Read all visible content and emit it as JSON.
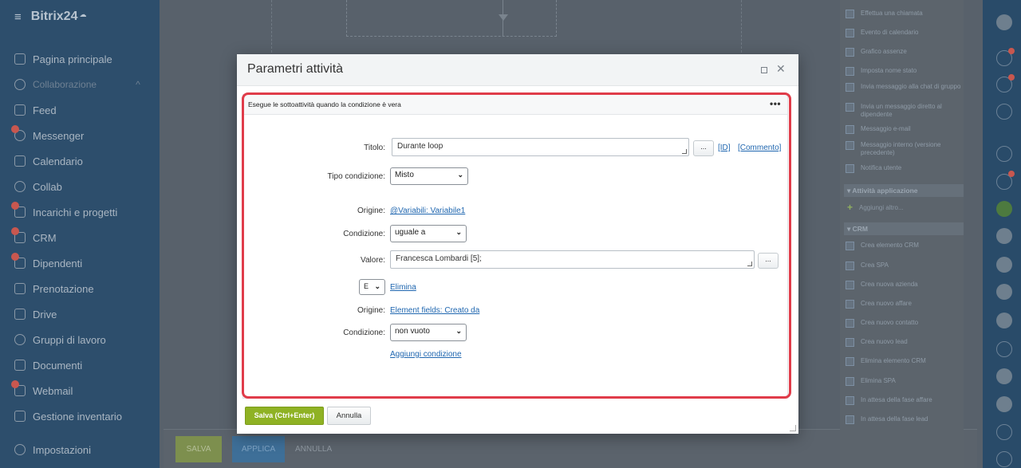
{
  "sidebar": {
    "brand": "Bitrix24",
    "items": [
      {
        "label": "Pagina principale"
      },
      {
        "label": "Collaborazione"
      },
      {
        "label": "Feed"
      },
      {
        "label": "Messenger"
      },
      {
        "label": "Calendario"
      },
      {
        "label": "Collab"
      },
      {
        "label": "Incarichi e progetti"
      },
      {
        "label": "CRM"
      },
      {
        "label": "Dipendenti"
      },
      {
        "label": "Prenotazione"
      },
      {
        "label": "Drive"
      },
      {
        "label": "Gruppi di lavoro"
      },
      {
        "label": "Documenti"
      },
      {
        "label": "Webmail"
      },
      {
        "label": "Gestione inventario"
      },
      {
        "label": "Impostazioni"
      }
    ]
  },
  "background_bar": {
    "save": "SALVA",
    "apply": "APPLICA",
    "cancel": "ANNULLA"
  },
  "right_panel": {
    "items_top": [
      "Effettua una chiamata",
      "Evento di calendario",
      "Grafico assenze",
      "Imposta nome stato",
      "Invia messaggio alla chat di gruppo",
      "Invia un messaggio diretto al dipendente",
      "Messaggio e-mail",
      "Messaggio interno (versione precedente)",
      "Notifica utente"
    ],
    "section_app": "Attività applicazione",
    "add_more": "Aggiungi altro...",
    "section_crm": "CRM",
    "items_crm": [
      "Crea elemento CRM",
      "Crea SPA",
      "Crea nuova azienda",
      "Crea nuovo affare",
      "Crea nuovo contatto",
      "Crea nuovo lead",
      "Elimina elemento CRM",
      "Elimina SPA",
      "In attesa della fase affare",
      "In attesa della fase lead"
    ]
  },
  "modal": {
    "title": "Parametri attività",
    "description": "Esegue le sottoattività quando la condizione è vera",
    "title_label": "Titolo:",
    "title_value": "Durante loop",
    "id_link": "[ID]",
    "comment_link": "[Commento]",
    "condition_type_label": "Tipo condizione:",
    "condition_type_value": "Misto",
    "origin_label": "Origine:",
    "origin1_value": "@Variabili: Variabile1",
    "condition_label": "Condizione:",
    "condition1_value": "uguale a",
    "value_label": "Valore:",
    "value1": "Francesca Lombardi [5];",
    "operator_value": "E",
    "delete_link": "Elimina",
    "origin2_value": "Element fields: Creato da",
    "condition2_value": "non vuoto",
    "add_condition_link": "Aggiungi condizione",
    "dots": "...",
    "save_button": "Salva (Ctrl+Enter)",
    "cancel_button": "Annulla"
  }
}
